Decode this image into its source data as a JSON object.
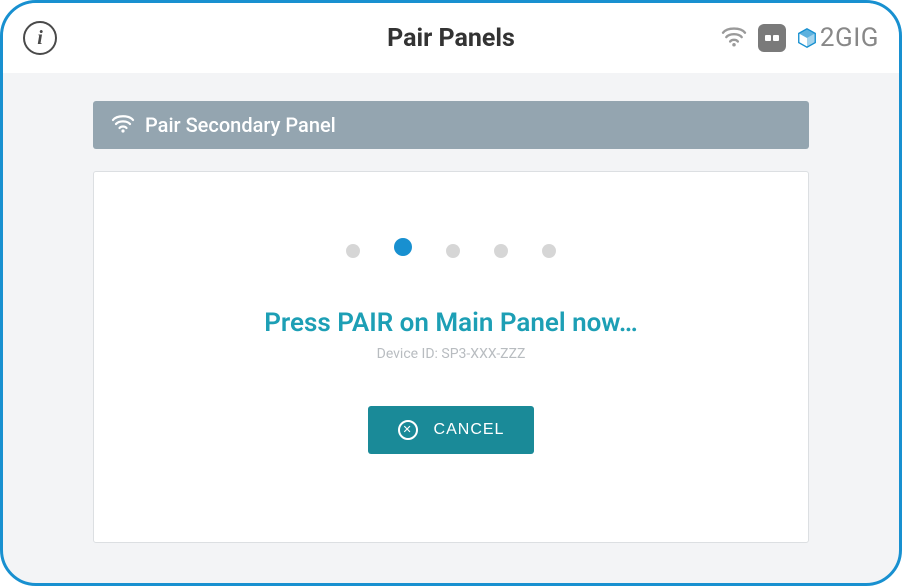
{
  "header": {
    "title": "Pair Panels",
    "brand": "2GIG"
  },
  "section": {
    "title": "Pair Secondary Panel"
  },
  "content": {
    "instruction": "Press PAIR on Main Panel now…",
    "device_id_label": "Device ID: SP3-XXX-ZZZ",
    "progress_active_index": 1,
    "progress_total": 5
  },
  "actions": {
    "cancel_label": "CANCEL"
  },
  "colors": {
    "accent": "#1890d0",
    "teal": "#1a8a98",
    "section_bar": "#94a5b0"
  },
  "icons": {
    "info": "info-icon",
    "wifi": "wifi-icon",
    "power": "power-plug-icon",
    "brand": "brand-cube-icon",
    "section_wifi": "wifi-icon",
    "cancel_x": "x-circle-icon"
  }
}
